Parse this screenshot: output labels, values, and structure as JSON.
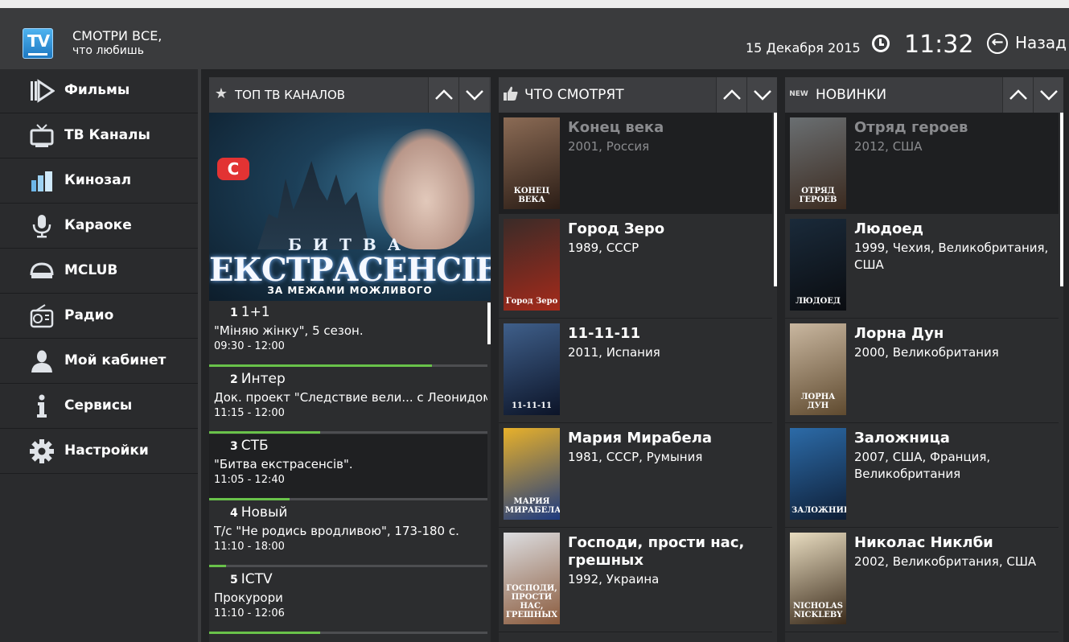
{
  "header": {
    "slogan_line1": "СМОТРИ ВСЕ,",
    "slogan_line2": "что любишь",
    "logo_text": "TV",
    "date": "15 Декабря 2015",
    "time": "11:32",
    "back_label": "Назад"
  },
  "sidebar": {
    "items": [
      {
        "label": "Фильмы",
        "icon": "film-play-icon"
      },
      {
        "label": "ТВ Каналы",
        "icon": "tv-icon"
      },
      {
        "label": "Кинозал",
        "icon": "cinema-hall-icon"
      },
      {
        "label": "Караоке",
        "icon": "microphone-icon"
      },
      {
        "label": "MCLUB",
        "icon": "mclub-icon"
      },
      {
        "label": "Радио",
        "icon": "radio-icon"
      },
      {
        "label": "Мой кабинет",
        "icon": "user-icon"
      },
      {
        "label": "Сервисы",
        "icon": "info-icon"
      },
      {
        "label": "Настройки",
        "icon": "gear-icon"
      }
    ]
  },
  "top_channels": {
    "title": "ТОП ТВ КАНАЛОВ",
    "poster": {
      "channel_logo": "С",
      "line1": "БИТВА",
      "line2": "ЕКСТРАСЕНСІВ",
      "line3": "ЗА МЕЖАМИ МОЖЛИВОГО"
    },
    "items": [
      {
        "num": "1",
        "channel": "1+1",
        "program": "\"Міняю жінку\", 5 сезон.",
        "time": "09:30 - 12:00",
        "progress": 0.8
      },
      {
        "num": "2",
        "channel": "Интер",
        "program": "Док. проект \"Следствие вели... с Леонидом",
        "time": "11:15 - 12:00",
        "progress": 0.4
      },
      {
        "num": "3",
        "channel": "СТБ",
        "program": "\"Битва екстрасенсів\".",
        "time": "11:05 - 12:40",
        "progress": 0.29
      },
      {
        "num": "4",
        "channel": "Новый",
        "program": "Т/с \"Не родись вродливою\", 173-180 с.",
        "time": "11:10 - 18:00",
        "progress": 0.06
      },
      {
        "num": "5",
        "channel": "ICTV",
        "program": "Прокурори",
        "time": "11:10 - 12:06",
        "progress": 0.4
      }
    ]
  },
  "watching": {
    "title": "ЧТО СМОТРЯТ",
    "items": [
      {
        "title": "Конец века",
        "meta": "2001, Россия",
        "poster_text": "КОНЕЦ ВЕКА",
        "colors": [
          "#8b6b55",
          "#2b1d16"
        ]
      },
      {
        "title": "Город Зеро",
        "meta": "1989, СССР",
        "poster_text": "Город Зеро",
        "colors": [
          "#3a2b28",
          "#a52a1a"
        ]
      },
      {
        "title": "11-11-11",
        "meta": "2011, Испания",
        "poster_text": "11-11-11",
        "colors": [
          "#3f5f8a",
          "#0c1428"
        ]
      },
      {
        "title": "Мария Мирабела",
        "meta": "1981, СССР, Румыния",
        "poster_text": "МАРИЯ МИРАБЕЛА",
        "colors": [
          "#e8b12a",
          "#1d3a80"
        ]
      },
      {
        "title": "Господи, прости нас, грешных",
        "meta": "1992, Украина",
        "poster_text": "ГОСПОДИ, ПРОСТИ НАС, ГРЕШНЫХ",
        "colors": [
          "#dcdde0",
          "#8a5a3c"
        ]
      }
    ]
  },
  "new_releases": {
    "badge": "NEW",
    "title": "НОВИНКИ",
    "items": [
      {
        "title": "Отряд героев",
        "meta": "2012, США",
        "poster_text": "ОТРЯД ГЕРОЕВ",
        "colors": [
          "#6a6f72",
          "#3b2a1f"
        ]
      },
      {
        "title": "Людоед",
        "meta": "1999, Чехия, Великобритания, США",
        "poster_text": "ЛЮДОЕД",
        "colors": [
          "#1a2a3a",
          "#0a0c10"
        ]
      },
      {
        "title": "Лорна Дун",
        "meta": "2000, Великобритания",
        "poster_text": "ЛОРНА ДУН",
        "colors": [
          "#c9b7a0",
          "#5f4a2f"
        ]
      },
      {
        "title": "Заложница",
        "meta": "2007, США, Франция, Великобритания",
        "poster_text": "ЗАЛОЖНИЦА",
        "colors": [
          "#2c6ba8",
          "#0e1e36"
        ]
      },
      {
        "title": "Николас Никлби",
        "meta": "2002, Великобритания, США",
        "poster_text": "NICHOLAS NICKLEBY",
        "colors": [
          "#e8dcc0",
          "#3a2a1a"
        ]
      }
    ]
  }
}
